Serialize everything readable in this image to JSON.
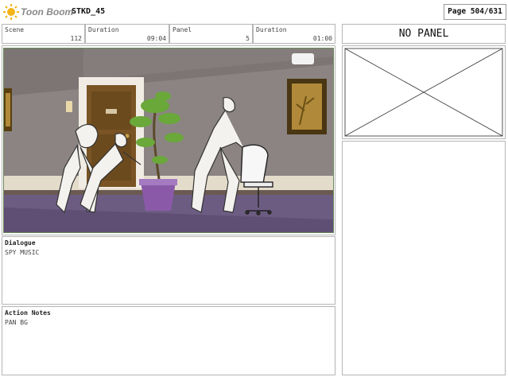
{
  "header": {
    "brand": "Toon Boom",
    "project": "STKD_45",
    "page": "Page 504/631"
  },
  "fields": {
    "scene_label": "Scene",
    "scene_value": "112",
    "scene_duration_label": "Duration",
    "scene_duration_value": "09:04",
    "panel_label": "Panel",
    "panel_value": "5",
    "panel_duration_label": "Duration",
    "panel_duration_value": "01:00"
  },
  "dialogue": {
    "label": "Dialogue",
    "text": "SPY MUSIC"
  },
  "action_notes": {
    "label": "Action Notes",
    "text": "PAN BG"
  },
  "next_panel": {
    "label": "NO PANEL"
  },
  "colors": {
    "wall": "#8a8382",
    "floor": "#6d5c82",
    "door": "#7a5424",
    "pot": "#8a5aa8",
    "frame_green": "#6a8a5a"
  },
  "icons": {
    "logo": "toon-boom-sun-icon"
  }
}
